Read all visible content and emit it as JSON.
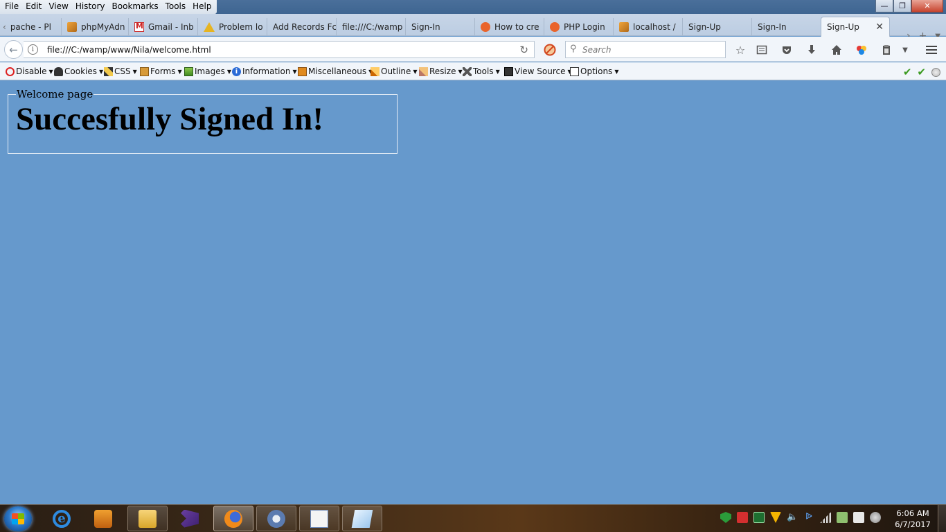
{
  "menu": [
    "File",
    "Edit",
    "View",
    "History",
    "Bookmarks",
    "Tools",
    "Help"
  ],
  "tabs": [
    {
      "label": "pache - Pl",
      "icon": "none"
    },
    {
      "label": "phpMyAdn",
      "icon": "phpmyadmin-icon"
    },
    {
      "label": "Gmail - Inb",
      "icon": "gmail-icon"
    },
    {
      "label": "Problem lo",
      "icon": "warning-icon"
    },
    {
      "label": "Add Records Fc",
      "icon": "none"
    },
    {
      "label": "file:///C:/wamp",
      "icon": "none"
    },
    {
      "label": "Sign-In",
      "icon": "none"
    },
    {
      "label": "How to cre",
      "icon": "ubuntu-icon"
    },
    {
      "label": "PHP Login",
      "icon": "ubuntu-icon"
    },
    {
      "label": "localhost /",
      "icon": "phpmyadmin-icon"
    },
    {
      "label": "Sign-Up",
      "icon": "none"
    },
    {
      "label": "Sign-In",
      "icon": "none"
    },
    {
      "label": "Sign-Up",
      "icon": "none",
      "active": true
    }
  ],
  "nav": {
    "url": "file:///C:/wamp/www/Nila/welcome.html",
    "search_placeholder": "Search"
  },
  "devtoolbar": [
    {
      "label": "Disable",
      "icon": "disable-icon"
    },
    {
      "label": "Cookies",
      "icon": "cookie-person-icon"
    },
    {
      "label": "CSS",
      "icon": "pencil-icon"
    },
    {
      "label": "Forms",
      "icon": "form-icon"
    },
    {
      "label": "Images",
      "icon": "image-icon"
    },
    {
      "label": "Information",
      "icon": "info-icon"
    },
    {
      "label": "Miscellaneous",
      "icon": "misc-icon"
    },
    {
      "label": "Outline",
      "icon": "outline-icon"
    },
    {
      "label": "Resize",
      "icon": "resize-icon"
    },
    {
      "label": "Tools",
      "icon": "tools-icon"
    },
    {
      "label": "View Source",
      "icon": "source-icon"
    },
    {
      "label": "Options",
      "icon": "options-icon"
    }
  ],
  "page": {
    "legend": "Welcome page",
    "heading": "Succesfully Signed In!",
    "background": "#6699cc"
  },
  "taskbar": {
    "time": "6:06 AM",
    "date": "6/7/2017"
  }
}
